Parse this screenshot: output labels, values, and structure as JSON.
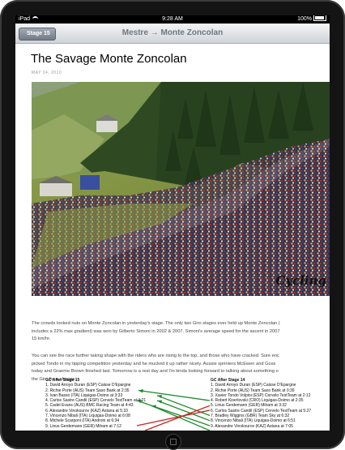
{
  "status": {
    "carrier": "iPad",
    "time": "9:28 AM",
    "battery": "100%"
  },
  "nav": {
    "back_label": "Stage 15",
    "title": "Mestre → Monte Zoncolan"
  },
  "article": {
    "title": "The Savage Monte Zoncolan",
    "date": "MAY 24, 2010",
    "photo_logo": "Cycling",
    "para1": [
      "The crowds looked nuts on Monte Zoncolan in yesterday's stage. The only two Giro stages ever held up Monte Zoncolan (",
      "includes a 22% max gradient) was won by Gilberto Simoni in 2002 & 2007.  Simoni's average speed for the ascent in 2007",
      "15 km/hr."
    ],
    "para2": [
      "You can see the race further taking shape with the riders who are rising to the top, and those who have cracked.  Sure enc",
      "picked Tondo in my tipping competition yesterday and he mucked it up rather nicely.  Aussie sprinters McEwen and Goss",
      "today and Graeme Brown finished last.  Tomorrow is a rest day and I'm kinda looking forward to talking about something o",
      "the Giro for a change."
    ]
  },
  "gc_left": {
    "heading": "GC After Stage 15",
    "rows": [
      "1. David Arroyo Duran (ESP) Caisse D'Epargne",
      "2. Richie Porte (AUS) Team Saxo Bank at 2:35",
      "3. Ivan Basso (ITA) Liquigas-Doimo at 3:33",
      "4. Carlos Sastre Candil (ESP) Cervelo TestTeam at 4:21",
      "5. Cadel Evans (AUS) BMC Racing Team at 4:43",
      "6. Alexandre Vinokourov (KAZ) Astana at 5:33",
      "7. Vincenzo Nibali (ITA) Liquigas-Doimo at 6:08",
      "8. Michele Scarponi (ITA) Androni at 6:34",
      "9. Linus Gerdemann (GER) Milram at 7:12"
    ]
  },
  "gc_right": {
    "heading": "GC After Stage 14",
    "rows": [
      "1. David Arroyo Duran (ESP) Caisse D'Epargne",
      "2. Richie Porte (AUS) Team Saxo Bank at 0:39",
      "3. Xavier Tondo Volpini (ESP) Cervelo TestTeam at 2:12",
      "4. Robert Kiserlovski (CRO) Liquigas-Doimo at 2:35",
      "5. Linus Gerdemann (GER) Milram at 3:32",
      "6. Carlos Sastre Candil (ESP) Cervelo TestTeam at 5:27",
      "7. Bradley Wiggins (GBR) Team Sky at 6:32",
      "8. Vincenzo Nibali (ITA) Liquigas-Doimo at 6:51",
      "9. Alexandre Vinokourov (KAZ) Astana at 7:05"
    ]
  },
  "colors": {
    "arrow_up": "#1f8a2a",
    "arrow_down": "#c0261f",
    "nav_text": "#6d7782"
  }
}
